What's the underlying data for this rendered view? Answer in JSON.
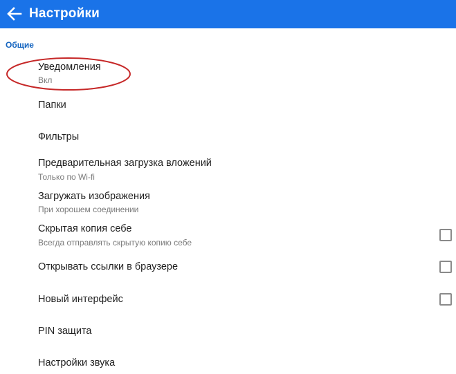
{
  "header": {
    "title": "Настройки",
    "back_icon": "arrow-left-icon",
    "bg_color": "#1a73e8"
  },
  "section": {
    "general_label": "Общие",
    "label_color": "#1565c0"
  },
  "preferences": [
    {
      "title": "Уведомления",
      "summary": "Вкл"
    },
    {
      "title": "Папки"
    },
    {
      "title": "Фильтры"
    },
    {
      "title": "Предварительная загрузка вложений",
      "summary": "Только по Wi-fi"
    },
    {
      "title": "Загружать изображения",
      "summary": "При хорошем соединении"
    },
    {
      "title": "Скрытая копия себе",
      "summary": "Всегда отправлять скрытую копию себе",
      "checked": false
    },
    {
      "title": "Открывать ссылки в браузере",
      "checked": false
    },
    {
      "title": "Новый интерфейс",
      "checked": false
    },
    {
      "title": "PIN защита"
    },
    {
      "title": "Настройки звука"
    }
  ],
  "annotation": {
    "shape": "ellipse",
    "color": "#c62828",
    "target": "Уведомления"
  }
}
